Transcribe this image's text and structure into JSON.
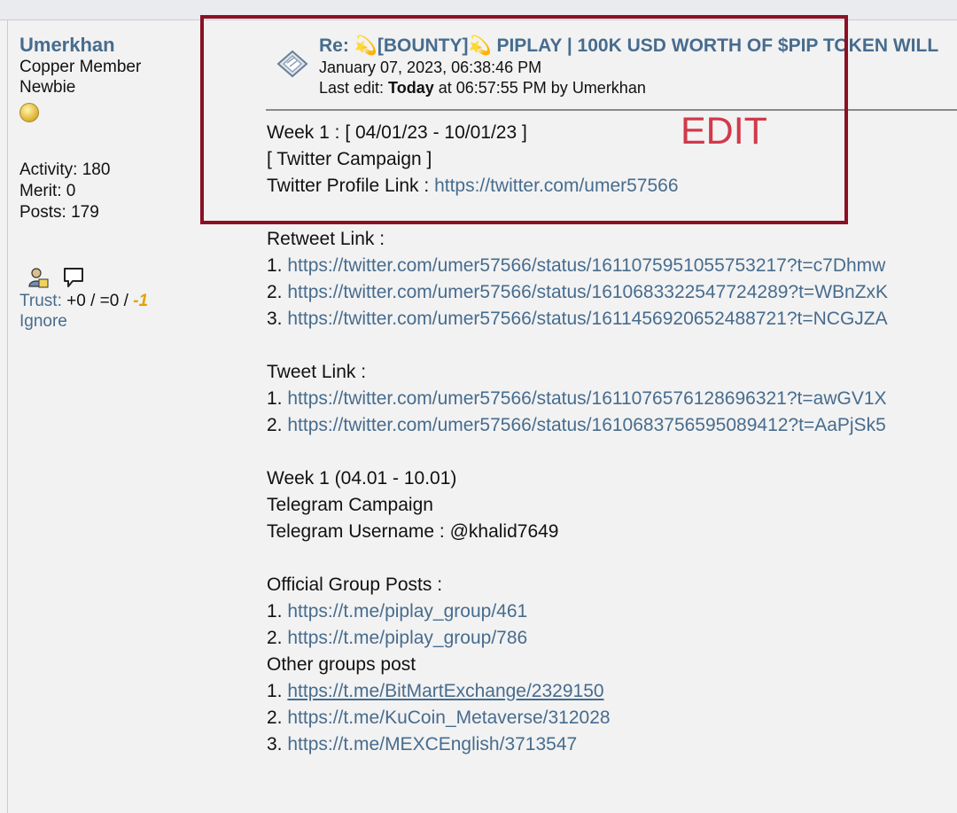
{
  "poster": {
    "name": "Umerkhan",
    "rank_lines": [
      "Copper Member",
      "Newbie"
    ],
    "activity": "Activity: 180",
    "merit": "Merit: 0",
    "posts": "Posts: 179",
    "trust_label": "Trust:",
    "trust_values": " +0 / =0 / ",
    "trust_neg": "-1",
    "ignore": "Ignore"
  },
  "post": {
    "subject": "Re: 💫[BOUNTY]💫 PIPLAY | 100K USD WORTH OF $PIP TOKEN WILL",
    "date": "January 07, 2023, 06:38:46 PM",
    "edit_prefix": "Last edit: ",
    "edit_today": "Today",
    "edit_suffix": " at 06:57:55 PM by Umerkhan"
  },
  "annotation": {
    "label": "EDIT",
    "color": "#8b1024"
  },
  "content": {
    "week1_header": "Week 1 : [ 04/01/23 - 10/01/23 ]",
    "twitter_campaign": "[ Twitter Campaign ]",
    "profile_label": "Twitter Profile Link : ",
    "profile_link": "https://twitter.com/umer57566",
    "retweet_label": "Retweet Link :",
    "retweets": [
      {
        "n": "1. ",
        "url": "https://twitter.com/umer57566/status/1611075951055753217?t=c7Dhmw"
      },
      {
        "n": "2. ",
        "url": "https://twitter.com/umer57566/status/1610683322547724289?t=WBnZxK"
      },
      {
        "n": "3. ",
        "url": "https://twitter.com/umer57566/status/1611456920652488721?t=NCGJZA"
      }
    ],
    "tweet_label": "Tweet Link :",
    "tweets": [
      {
        "n": "1. ",
        "url": "https://twitter.com/umer57566/status/1611076576128696321?t=awGV1X"
      },
      {
        "n": "2. ",
        "url": "https://twitter.com/umer57566/status/1610683756595089412?t=AaPjSk5"
      }
    ],
    "week1_tg": "Week 1 (04.01 - 10.01)",
    "telegram_campaign": "Telegram Campaign",
    "tg_username": "Telegram Username : @khalid7649",
    "official_label": "Official Group Posts :",
    "official": [
      {
        "n": "1. ",
        "url": "https://t.me/piplay_group/461"
      },
      {
        "n": "2. ",
        "url": "https://t.me/piplay_group/786"
      }
    ],
    "other_label": "Other groups post",
    "other": [
      {
        "n": "1. ",
        "url": "https://t.me/BitMartExchange/2329150"
      },
      {
        "n": "2. ",
        "url": "https://t.me/KuCoin_Metaverse/312028"
      },
      {
        "n": "3. ",
        "url": "https://t.me/MEXCEnglish/3713547"
      }
    ]
  }
}
